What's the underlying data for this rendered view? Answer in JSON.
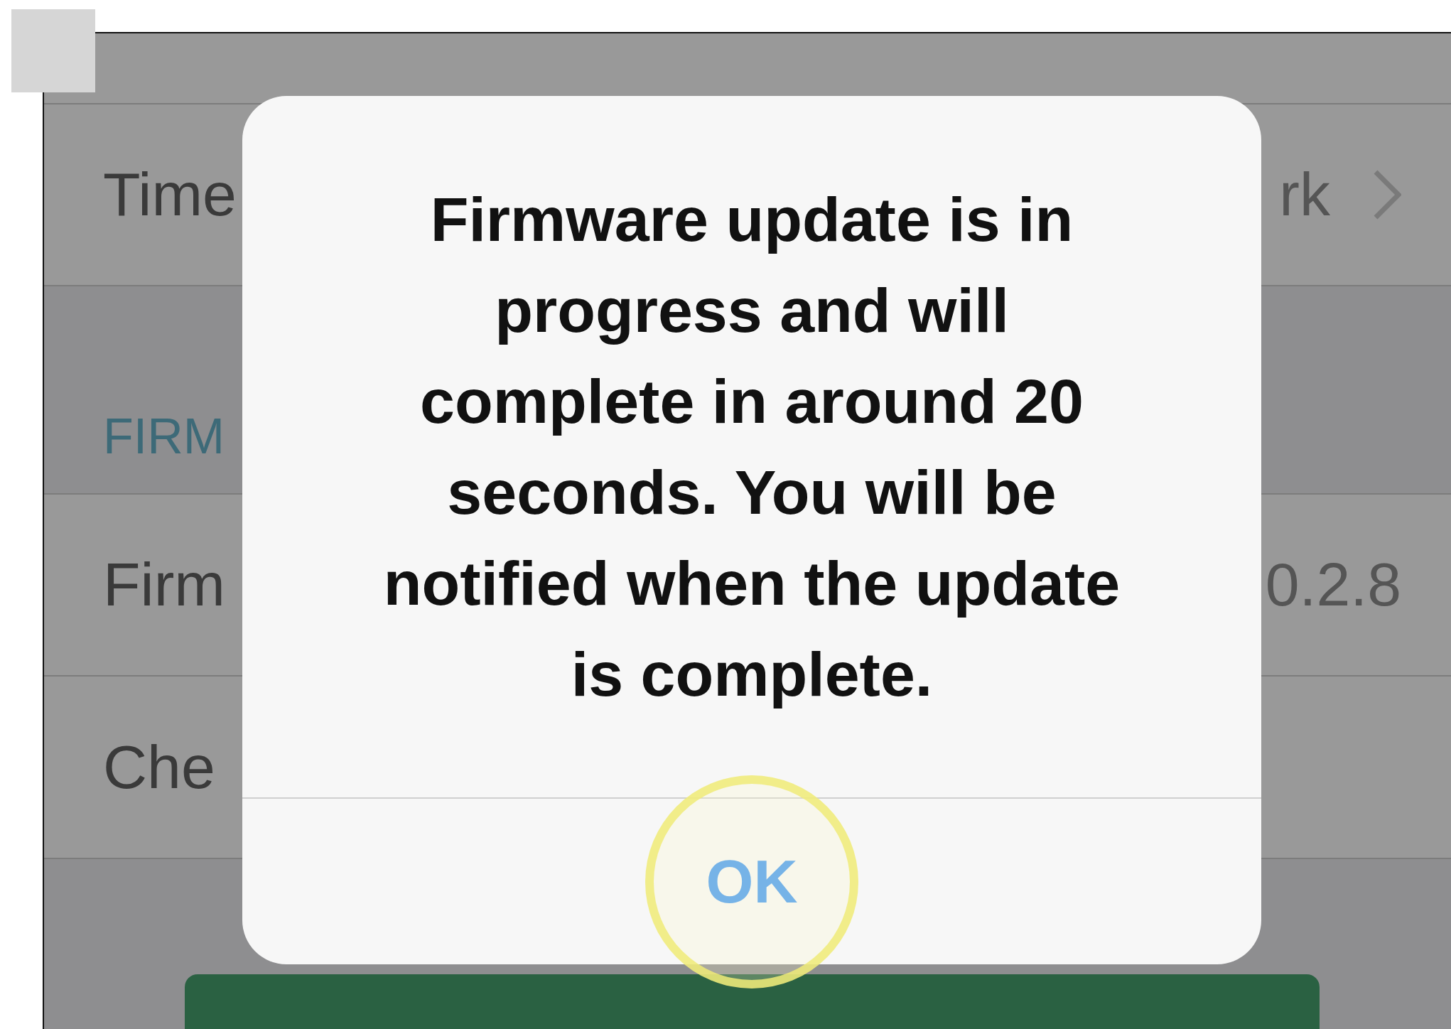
{
  "settings_rows": [
    {
      "kind": "row"
    },
    {
      "kind": "row",
      "label": "Time",
      "value": "rk",
      "chevron": true
    },
    {
      "kind": "header",
      "label": "FIRM"
    },
    {
      "kind": "row",
      "label": "Firm",
      "value": "0.2.8",
      "chevron": false
    },
    {
      "kind": "row",
      "label": "Che",
      "chevron": false
    }
  ],
  "alert": {
    "message": "Firmware update is in progress and will complete in around 20 seconds. You will be notified when the update is complete.",
    "buttons": [
      {
        "label": "OK",
        "touched": true
      }
    ]
  }
}
